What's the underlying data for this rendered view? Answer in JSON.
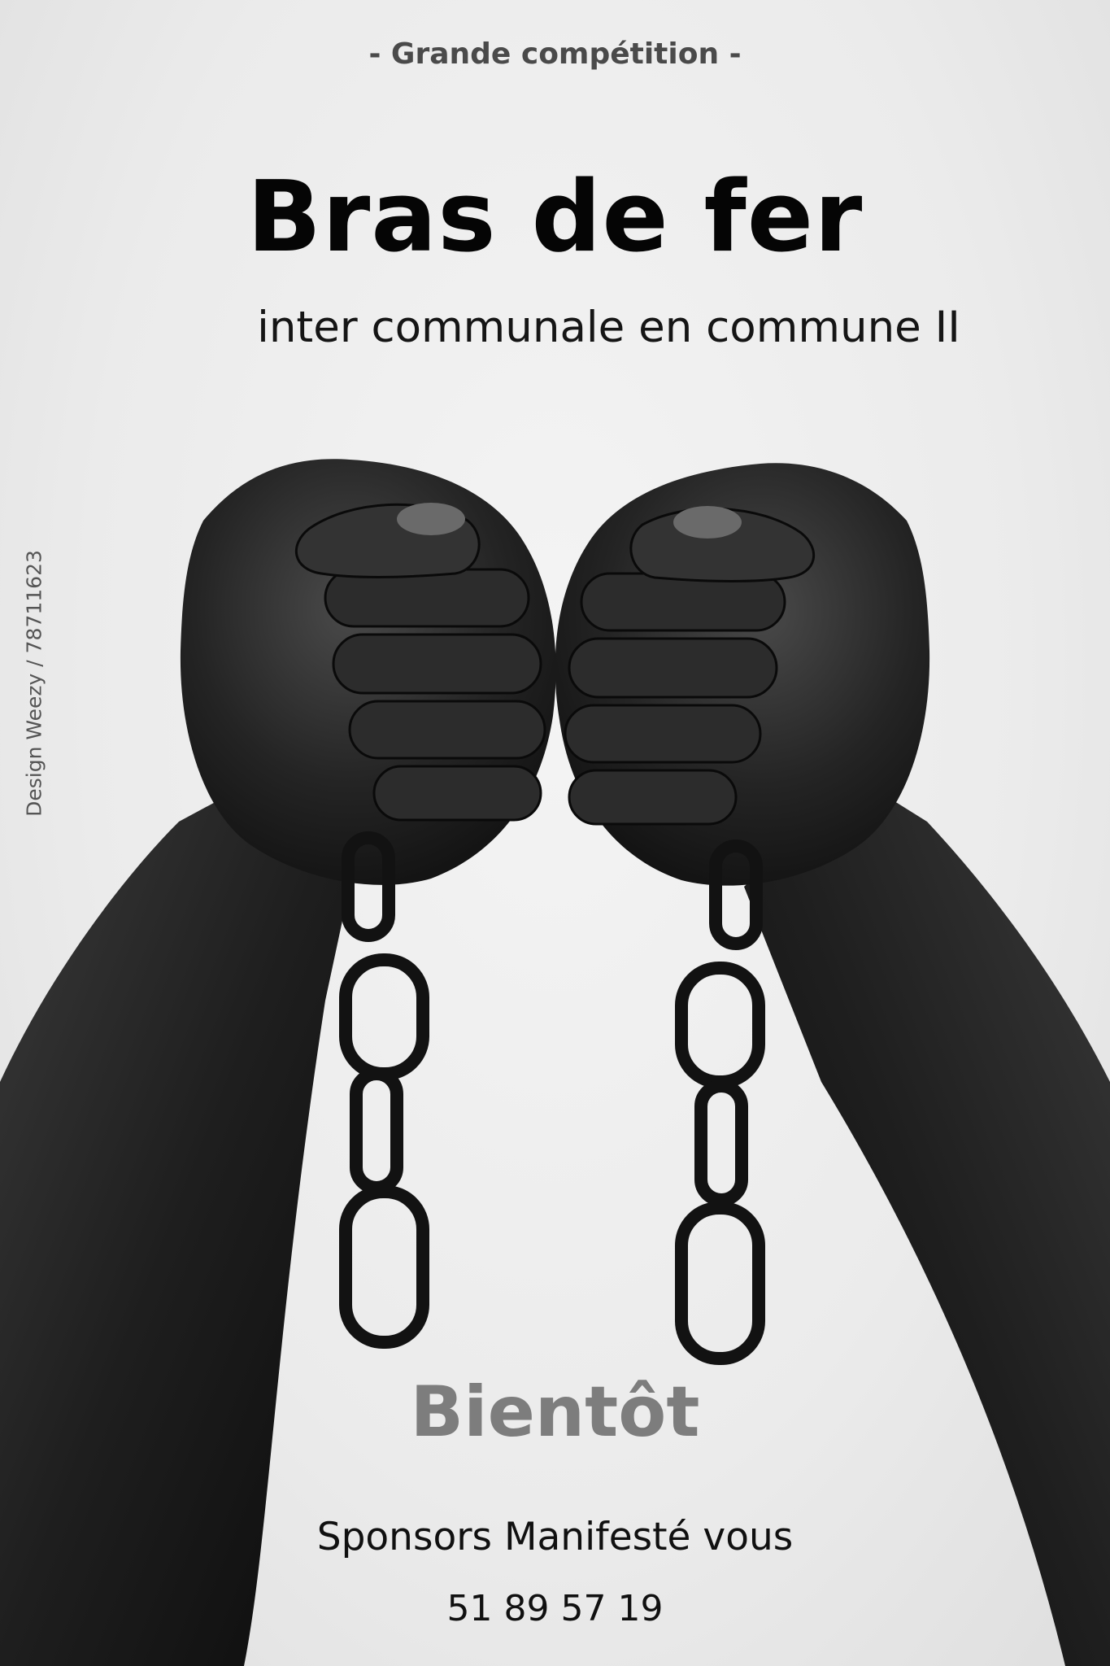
{
  "poster": {
    "kicker": "- Grande compétition -",
    "title": "Bras de fer",
    "subtitle": "inter communale en commune II",
    "status": "Bientôt",
    "sponsors": "Sponsors Manifesté vous",
    "phone": "51 89 57 19",
    "credit": "Design Weezy / 78711623"
  },
  "colors": {
    "background": "#ececec",
    "title": "#050505",
    "status": "#7d7d7d",
    "skin": "#1c1c1c"
  }
}
